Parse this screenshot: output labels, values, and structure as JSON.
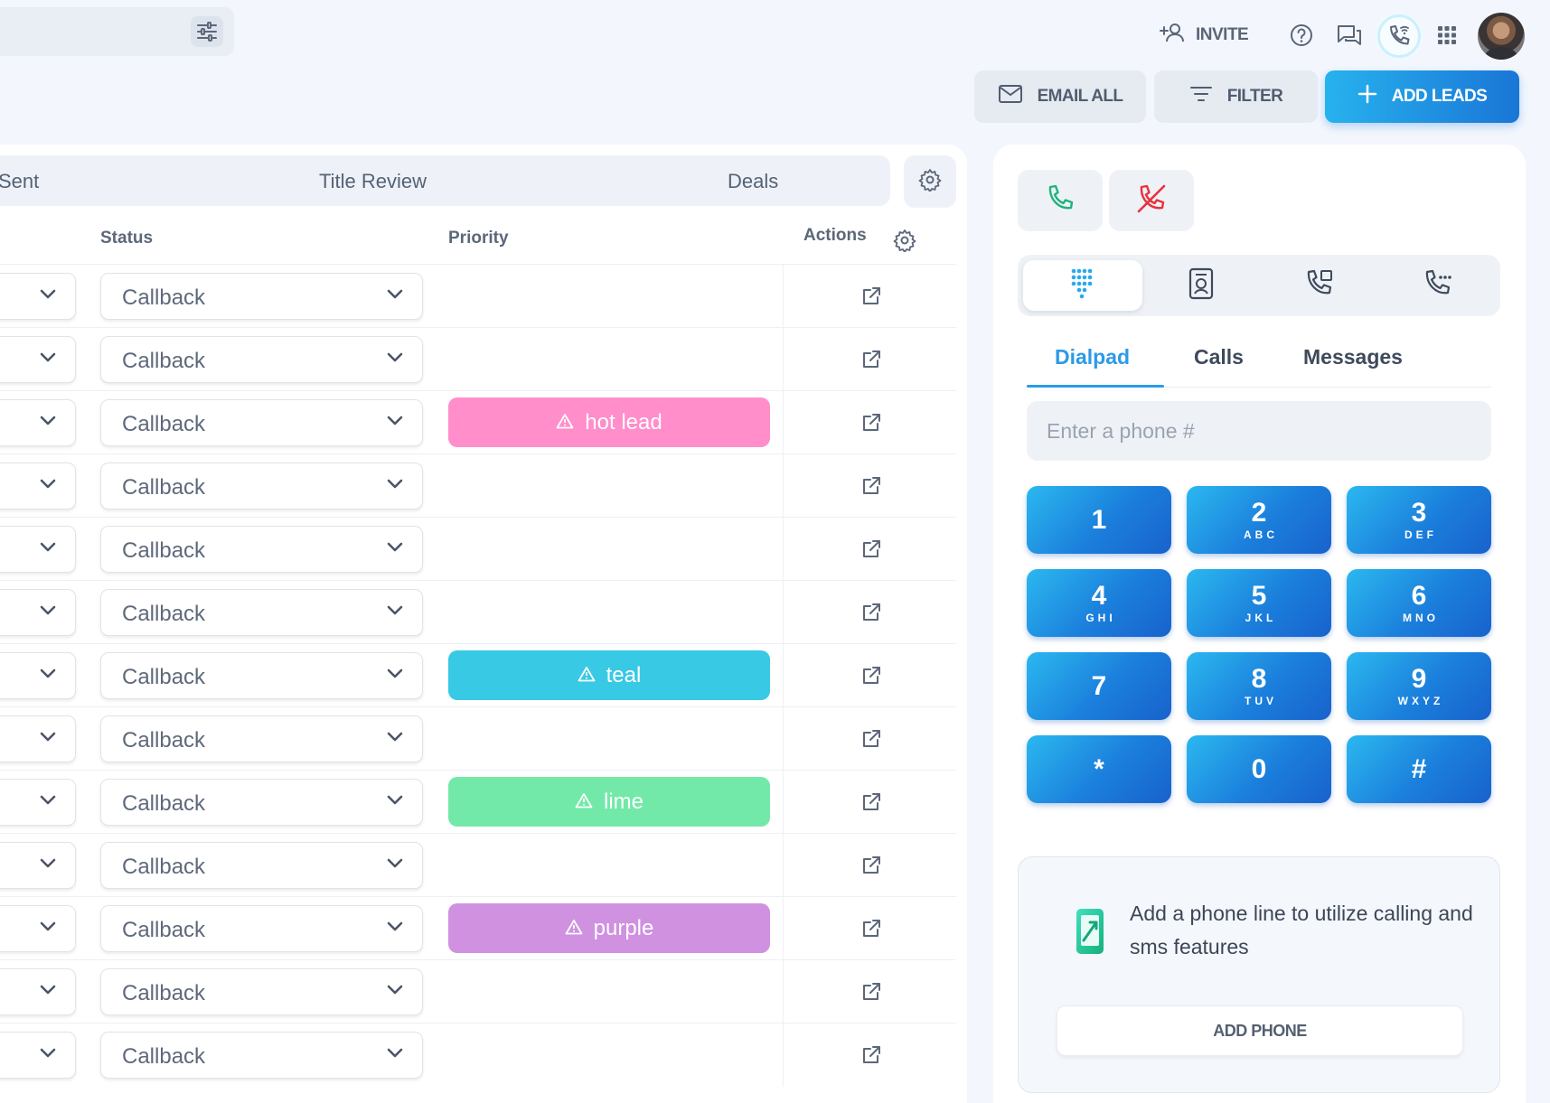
{
  "header": {
    "invite_label": "INVITE",
    "email_all_label": "EMAIL ALL",
    "filter_label": "FILTER",
    "add_leads_label": "ADD LEADS"
  },
  "stages": [
    "Sent",
    "Title Review",
    "Deals"
  ],
  "table": {
    "headers": {
      "status": "Status",
      "priority": "Priority",
      "actions": "Actions"
    },
    "rows": [
      {
        "status": "Callback",
        "priority": "",
        "priority_color": ""
      },
      {
        "status": "Callback",
        "priority": "",
        "priority_color": ""
      },
      {
        "status": "Callback",
        "priority": "hot lead",
        "priority_color": "#ff8ecb"
      },
      {
        "status": "Callback",
        "priority": "",
        "priority_color": ""
      },
      {
        "status": "Callback",
        "priority": "",
        "priority_color": ""
      },
      {
        "status": "Callback",
        "priority": "",
        "priority_color": ""
      },
      {
        "status": "Callback",
        "priority": "teal",
        "priority_color": "#38c9e4"
      },
      {
        "status": "Callback",
        "priority": "",
        "priority_color": ""
      },
      {
        "status": "Callback",
        "priority": "lime",
        "priority_color": "#72e9a8"
      },
      {
        "status": "Callback",
        "priority": "",
        "priority_color": ""
      },
      {
        "status": "Callback",
        "priority": "purple",
        "priority_color": "#cf91e0"
      },
      {
        "status": "Callback",
        "priority": "",
        "priority_color": ""
      },
      {
        "status": "Callback",
        "priority": "",
        "priority_color": ""
      }
    ]
  },
  "dialer": {
    "tabs": [
      "Dialpad",
      "Calls",
      "Messages"
    ],
    "active_tab": "Dialpad",
    "phone_placeholder": "Enter a phone #",
    "keys": [
      {
        "num": "1",
        "letters": ""
      },
      {
        "num": "2",
        "letters": "ABC"
      },
      {
        "num": "3",
        "letters": "DEF"
      },
      {
        "num": "4",
        "letters": "GHI"
      },
      {
        "num": "5",
        "letters": "JKL"
      },
      {
        "num": "6",
        "letters": "MNO"
      },
      {
        "num": "7",
        "letters": ""
      },
      {
        "num": "8",
        "letters": "TUV"
      },
      {
        "num": "9",
        "letters": "WXYZ"
      },
      {
        "num": "*",
        "letters": ""
      },
      {
        "num": "0",
        "letters": ""
      },
      {
        "num": "#",
        "letters": ""
      }
    ],
    "add_line_message": "Add a phone line to utilize calling and sms features",
    "add_phone_label": "ADD PHONE"
  },
  "colors": {
    "accent": "#2c9ae8",
    "call_green": "#20b37a",
    "hangup_red": "#e8323c"
  },
  "icons": [
    "tune-icon",
    "add-person-icon",
    "help-icon",
    "chat-icon",
    "wifi-call-icon",
    "apps-grid-icon",
    "mail-icon",
    "filter-icon",
    "plus-icon",
    "gear-icon",
    "chevron-down-icon",
    "open-external-icon",
    "warning-icon",
    "phone-icon",
    "phone-off-icon",
    "dialpad-icon",
    "contact-card-icon",
    "phone-forward-icon",
    "phone-dots-icon",
    "phone-line-icon"
  ]
}
